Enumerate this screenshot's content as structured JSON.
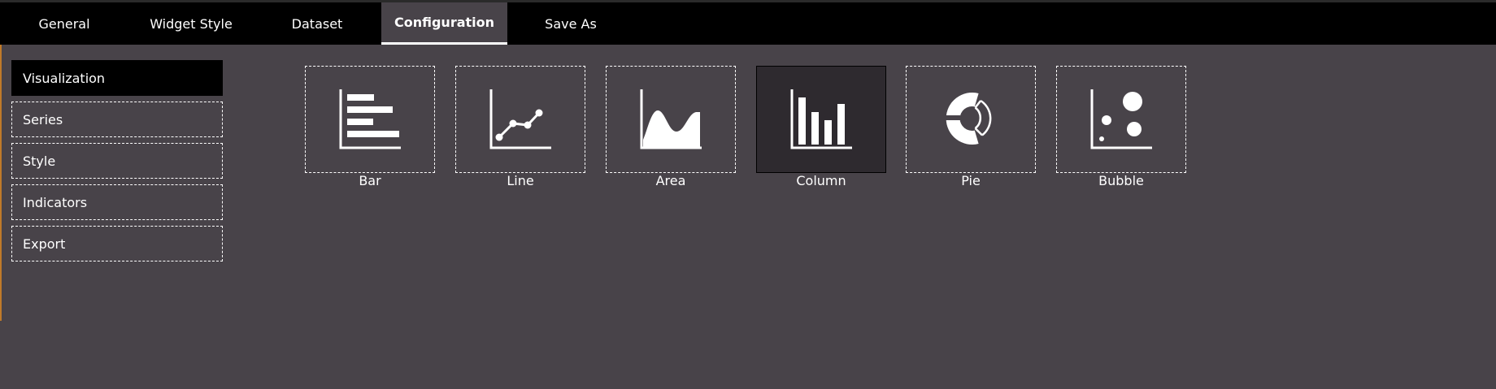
{
  "tabs": [
    {
      "label": "General"
    },
    {
      "label": "Widget Style"
    },
    {
      "label": "Dataset"
    },
    {
      "label": "Configuration",
      "active": true
    },
    {
      "label": "Save As"
    }
  ],
  "sidebar": {
    "items": [
      {
        "label": "Visualization",
        "active": true
      },
      {
        "label": "Series"
      },
      {
        "label": "Style"
      },
      {
        "label": "Indicators"
      },
      {
        "label": "Export"
      }
    ]
  },
  "visualizations": [
    {
      "label": "Bar",
      "icon": "bar-chart-icon"
    },
    {
      "label": "Line",
      "icon": "line-chart-icon"
    },
    {
      "label": "Area",
      "icon": "area-chart-icon"
    },
    {
      "label": "Column",
      "icon": "column-chart-icon",
      "selected": true
    },
    {
      "label": "Pie",
      "icon": "pie-chart-icon"
    },
    {
      "label": "Bubble",
      "icon": "bubble-chart-icon"
    }
  ],
  "colors": {
    "topbar": "#000000",
    "background": "#484349",
    "selected_card": "#2e2a2f",
    "accent_edge": "#c07a2a"
  }
}
